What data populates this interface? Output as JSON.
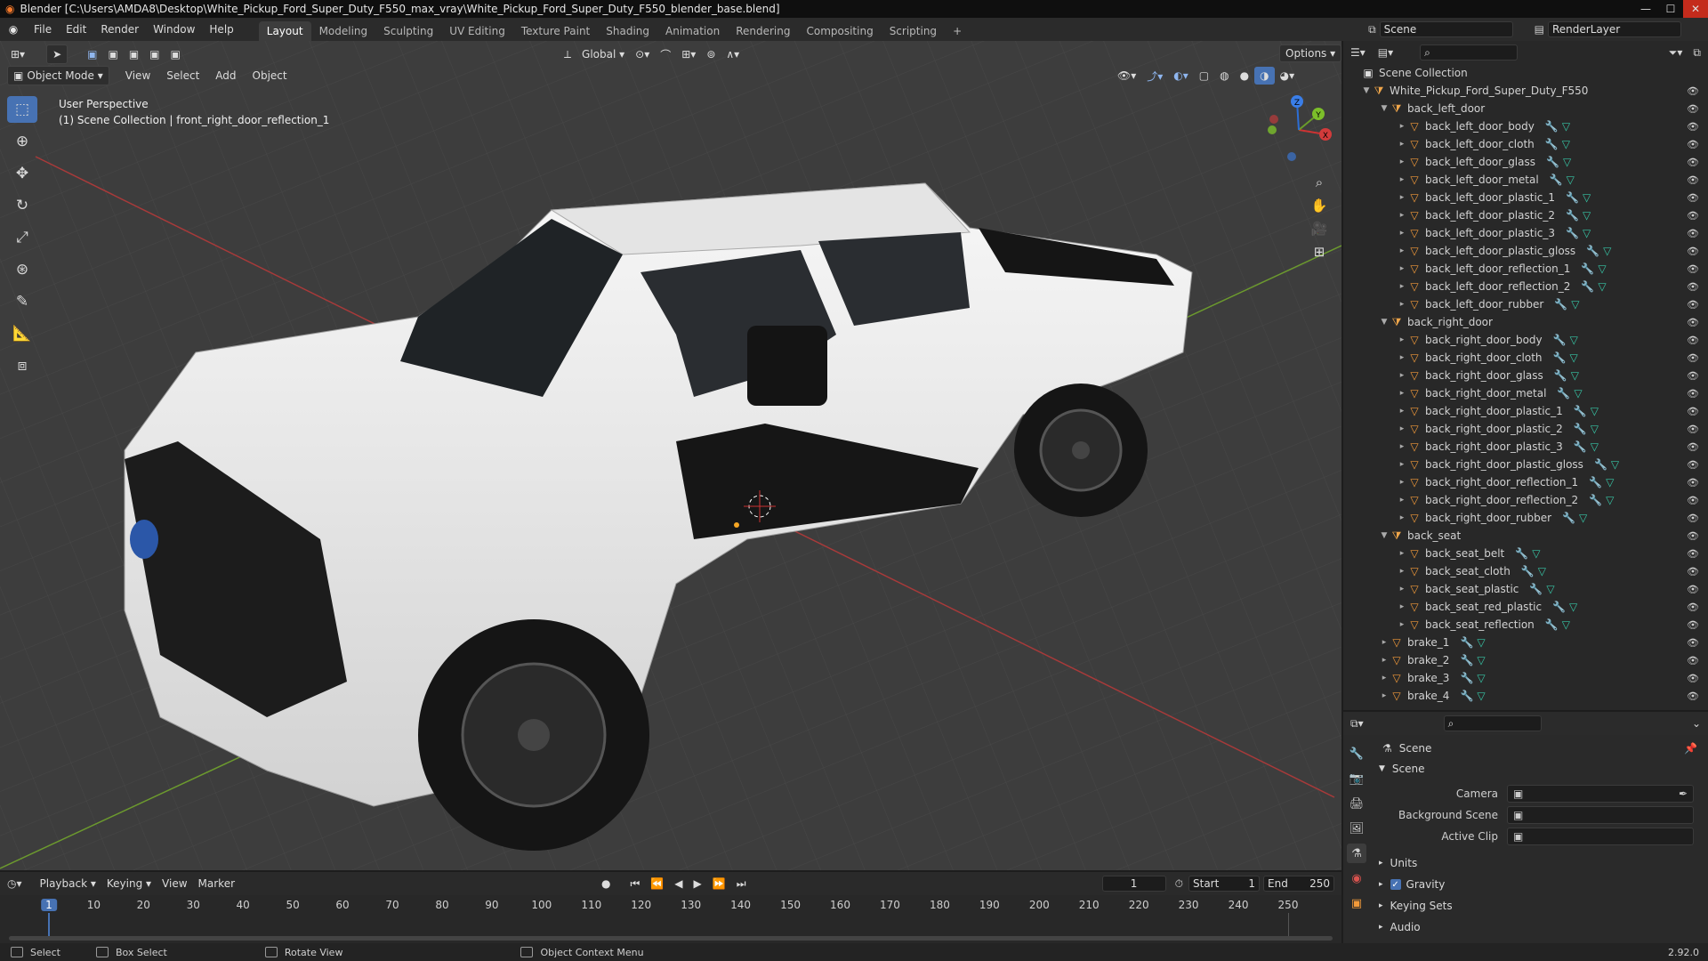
{
  "window": {
    "title": "Blender [C:\\Users\\AMDA8\\Desktop\\White_Pickup_Ford_Super_Duty_F550_max_vray\\White_Pickup_Ford_Super_Duty_F550_blender_base.blend]"
  },
  "menu": [
    "File",
    "Edit",
    "Render",
    "Window",
    "Help"
  ],
  "workspaces": [
    "Layout",
    "Modeling",
    "Sculpting",
    "UV Editing",
    "Texture Paint",
    "Shading",
    "Animation",
    "Rendering",
    "Compositing",
    "Scripting"
  ],
  "workspace_add": "+",
  "scene_field": "Scene",
  "renderlayer_field": "RenderLayer",
  "viewport": {
    "mode": "Object Mode",
    "menus": [
      "View",
      "Select",
      "Add",
      "Object"
    ],
    "orientation": "Global",
    "options": "Options",
    "perspective": "User Perspective",
    "context": "(1) Scene Collection | front_right_door_reflection_1",
    "gizmo_axes": [
      "X",
      "Y",
      "Z"
    ]
  },
  "outliner": {
    "root": "Scene Collection",
    "rows": [
      {
        "label": "White_Pickup_Ford_Super_Duty_F550",
        "kind": "coll",
        "level": 1,
        "open": true,
        "mods": false
      },
      {
        "label": "back_left_door",
        "kind": "coll",
        "level": 2,
        "open": true,
        "mods": false
      },
      {
        "label": "back_left_door_body",
        "kind": "mesh",
        "level": 3,
        "mods": true
      },
      {
        "label": "back_left_door_cloth",
        "kind": "mesh",
        "level": 3,
        "mods": true
      },
      {
        "label": "back_left_door_glass",
        "kind": "mesh",
        "level": 3,
        "mods": true
      },
      {
        "label": "back_left_door_metal",
        "kind": "mesh",
        "level": 3,
        "mods": true
      },
      {
        "label": "back_left_door_plastic_1",
        "kind": "mesh",
        "level": 3,
        "mods": true
      },
      {
        "label": "back_left_door_plastic_2",
        "kind": "mesh",
        "level": 3,
        "mods": true
      },
      {
        "label": "back_left_door_plastic_3",
        "kind": "mesh",
        "level": 3,
        "mods": true
      },
      {
        "label": "back_left_door_plastic_gloss",
        "kind": "mesh",
        "level": 3,
        "mods": true
      },
      {
        "label": "back_left_door_reflection_1",
        "kind": "mesh",
        "level": 3,
        "mods": true
      },
      {
        "label": "back_left_door_reflection_2",
        "kind": "mesh",
        "level": 3,
        "mods": true
      },
      {
        "label": "back_left_door_rubber",
        "kind": "mesh",
        "level": 3,
        "mods": true
      },
      {
        "label": "back_right_door",
        "kind": "coll",
        "level": 2,
        "open": true,
        "mods": false
      },
      {
        "label": "back_right_door_body",
        "kind": "mesh",
        "level": 3,
        "mods": true
      },
      {
        "label": "back_right_door_cloth",
        "kind": "mesh",
        "level": 3,
        "mods": true
      },
      {
        "label": "back_right_door_glass",
        "kind": "mesh",
        "level": 3,
        "mods": true
      },
      {
        "label": "back_right_door_metal",
        "kind": "mesh",
        "level": 3,
        "mods": true
      },
      {
        "label": "back_right_door_plastic_1",
        "kind": "mesh",
        "level": 3,
        "mods": true
      },
      {
        "label": "back_right_door_plastic_2",
        "kind": "mesh",
        "level": 3,
        "mods": true
      },
      {
        "label": "back_right_door_plastic_3",
        "kind": "mesh",
        "level": 3,
        "mods": true
      },
      {
        "label": "back_right_door_plastic_gloss",
        "kind": "mesh",
        "level": 3,
        "mods": true
      },
      {
        "label": "back_right_door_reflection_1",
        "kind": "mesh",
        "level": 3,
        "mods": true
      },
      {
        "label": "back_right_door_reflection_2",
        "kind": "mesh",
        "level": 3,
        "mods": true
      },
      {
        "label": "back_right_door_rubber",
        "kind": "mesh",
        "level": 3,
        "mods": true
      },
      {
        "label": "back_seat",
        "kind": "coll",
        "level": 2,
        "open": true,
        "mods": false
      },
      {
        "label": "back_seat_belt",
        "kind": "mesh",
        "level": 3,
        "mods": true
      },
      {
        "label": "back_seat_cloth",
        "kind": "mesh",
        "level": 3,
        "mods": true
      },
      {
        "label": "back_seat_plastic",
        "kind": "mesh",
        "level": 3,
        "mods": true
      },
      {
        "label": "back_seat_red_plastic",
        "kind": "mesh",
        "level": 3,
        "mods": true
      },
      {
        "label": "back_seat_reflection",
        "kind": "mesh",
        "level": 3,
        "mods": true
      },
      {
        "label": "brake_1",
        "kind": "mesh",
        "level": 2,
        "mods": true
      },
      {
        "label": "brake_2",
        "kind": "mesh",
        "level": 2,
        "mods": true
      },
      {
        "label": "brake_3",
        "kind": "mesh",
        "level": 2,
        "mods": true
      },
      {
        "label": "brake_4",
        "kind": "mesh",
        "level": 2,
        "mods": true
      }
    ]
  },
  "properties": {
    "header": "Scene",
    "panel": "Scene",
    "fields": [
      {
        "label": "Camera",
        "icon": "camera-icon"
      },
      {
        "label": "Background Scene",
        "icon": "scene-icon"
      },
      {
        "label": "Active Clip",
        "icon": "clip-icon"
      }
    ],
    "subpanels": [
      {
        "label": "Units",
        "checkbox": false
      },
      {
        "label": "Gravity",
        "checkbox": true
      },
      {
        "label": "Keying Sets",
        "checkbox": false
      },
      {
        "label": "Audio",
        "checkbox": false
      }
    ]
  },
  "timeline": {
    "menus": [
      "Playback",
      "Keying",
      "View",
      "Marker"
    ],
    "current_frame": "1",
    "start_label": "Start",
    "start": "1",
    "end_label": "End",
    "end": "250",
    "ticks": [
      "1",
      "10",
      "20",
      "30",
      "40",
      "50",
      "60",
      "70",
      "80",
      "90",
      "100",
      "110",
      "120",
      "130",
      "140",
      "150",
      "160",
      "170",
      "180",
      "190",
      "200",
      "210",
      "220",
      "230",
      "240",
      "250"
    ]
  },
  "statusbar": {
    "items": [
      "Select",
      "Box Select",
      "Rotate View",
      "Object Context Menu"
    ],
    "version": "2.92.0"
  },
  "colors": {
    "accent": "#4772b3",
    "collection_icon": "#f0a64a",
    "modifier_icon": "#5ba2e0",
    "data_icon": "#37c6a6"
  }
}
